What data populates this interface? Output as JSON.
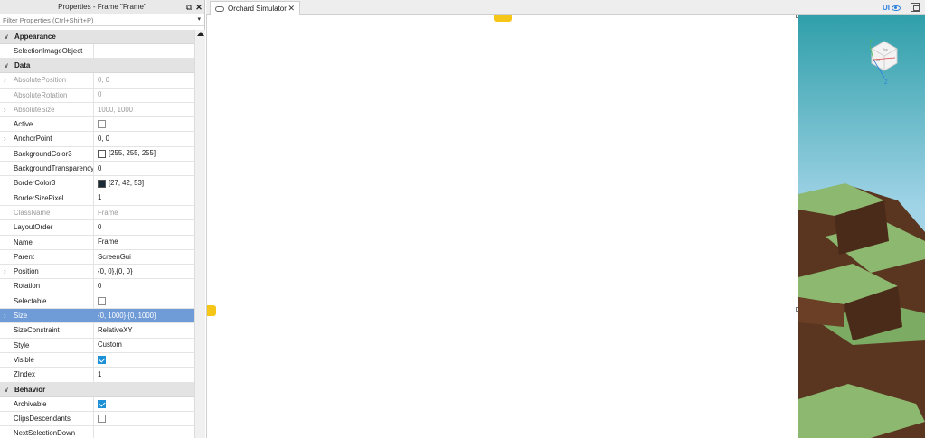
{
  "panel": {
    "title": "Properties - Frame \"Frame\"",
    "filter_placeholder": "Filter Properties (Ctrl+Shift+P)"
  },
  "sections": {
    "appearance": "Appearance",
    "data": "Data",
    "behavior": "Behavior"
  },
  "properties": {
    "selection_image_object": {
      "name": "SelectionImageObject",
      "value": ""
    },
    "absolute_position": {
      "name": "AbsolutePosition",
      "value": "0, 0"
    },
    "absolute_rotation": {
      "name": "AbsoluteRotation",
      "value": "0"
    },
    "absolute_size": {
      "name": "AbsoluteSize",
      "value": "1000, 1000"
    },
    "active": {
      "name": "Active",
      "checked": false
    },
    "anchor_point": {
      "name": "AnchorPoint",
      "value": "0, 0"
    },
    "background_color3": {
      "name": "BackgroundColor3",
      "value": "[255, 255, 255]",
      "swatch": "#ffffff"
    },
    "background_transparency": {
      "name": "BackgroundTransparency",
      "value": "0"
    },
    "border_color3": {
      "name": "BorderColor3",
      "value": "[27, 42, 53]",
      "swatch": "#1b2a35"
    },
    "border_size_pixel": {
      "name": "BorderSizePixel",
      "value": "1"
    },
    "class_name": {
      "name": "ClassName",
      "value": "Frame"
    },
    "layout_order": {
      "name": "LayoutOrder",
      "value": "0"
    },
    "name": {
      "name": "Name",
      "value": "Frame"
    },
    "parent": {
      "name": "Parent",
      "value": "ScreenGui"
    },
    "position": {
      "name": "Position",
      "value": "{0, 0},{0, 0}"
    },
    "rotation": {
      "name": "Rotation",
      "value": "0"
    },
    "selectable": {
      "name": "Selectable",
      "checked": false
    },
    "size": {
      "name": "Size",
      "value": "{0, 1000},{0, 1000}"
    },
    "size_constraint": {
      "name": "SizeConstraint",
      "value": "RelativeXY"
    },
    "style": {
      "name": "Style",
      "value": "Custom"
    },
    "visible": {
      "name": "Visible",
      "checked": true
    },
    "zindex": {
      "name": "ZIndex",
      "value": "1"
    },
    "archivable": {
      "name": "Archivable",
      "checked": true
    },
    "clips_descendants": {
      "name": "ClipsDescendants",
      "checked": false
    },
    "next_selection_down": {
      "name": "NextSelectionDown",
      "value": ""
    }
  },
  "tabs": [
    {
      "label": "Orchard Simulator"
    }
  ],
  "toolbar": {
    "ui_label": "UI"
  },
  "colors": {
    "selection": "#6f9bd6",
    "accent": "#2b7fe0",
    "handle_yellow": "#f5c518",
    "grass": "#8cb86f",
    "dirt": "#5a3520",
    "sky": "#b8dcec"
  },
  "viewcube": {
    "labels": [
      "Y",
      "Z",
      "Left",
      "Top"
    ]
  }
}
